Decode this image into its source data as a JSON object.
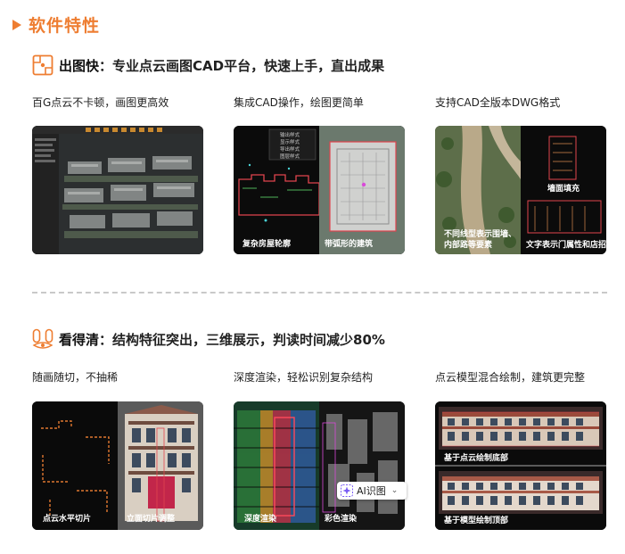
{
  "header": {
    "title": "软件特性"
  },
  "section1": {
    "highlight": "出图快",
    "rest": "：专业点云画图CAD平台，快速上手，直出成果",
    "features": [
      {
        "caption": "百G点云不卡顿，画图更高效",
        "labels": []
      },
      {
        "caption": "集成CAD操作，绘图更简单",
        "labels": [
          "复杂房屋轮廓",
          "带弧形的建筑"
        ],
        "menu": [
          "输出样式",
          "显示样式",
          "导出样式",
          "图层样式"
        ]
      },
      {
        "caption": "支持CAD全版本DWG格式",
        "labels": [
          "墙面填充",
          "不同线型表示围墙、",
          "内部路等要素",
          "文字表示门属性和店招"
        ]
      }
    ]
  },
  "section2": {
    "highlight": "看得清",
    "rest": "：结构特征突出，三维展示，判读时间减少80%",
    "features": [
      {
        "caption": "随画随切，不抽稀",
        "labels": [
          "点云水平切片",
          "立面切片调整"
        ]
      },
      {
        "caption": "深度渲染，轻松识别复杂结构",
        "labels": [
          "深度渲染",
          "彩色渲染"
        ]
      },
      {
        "caption": "点云模型混合绘制，建筑更完整",
        "labels": [
          "基于点云绘制底部",
          "基于模型绘制顶部"
        ]
      }
    ]
  },
  "ai_badge": {
    "label": "AI识图"
  },
  "colors": {
    "accent": "#ee7d31"
  }
}
